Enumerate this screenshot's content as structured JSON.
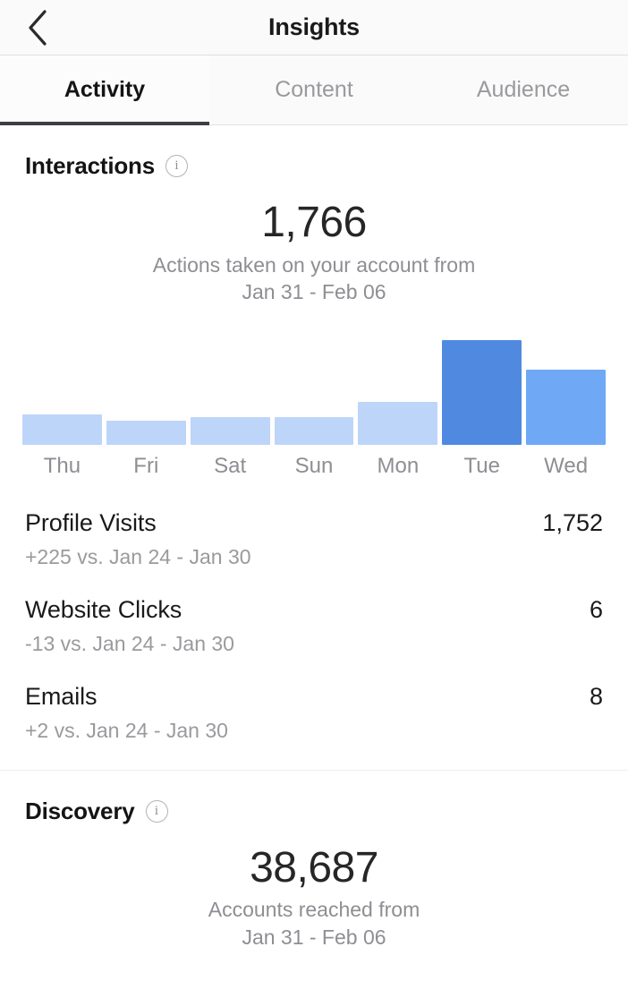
{
  "header": {
    "title": "Insights",
    "back_icon": "chevron-left-icon"
  },
  "tabs": [
    {
      "label": "Activity",
      "active": true
    },
    {
      "label": "Content",
      "active": false
    },
    {
      "label": "Audience",
      "active": false
    }
  ],
  "interactions": {
    "title": "Interactions",
    "info_icon": "info-circle-icon",
    "value": "1,766",
    "description_line1": "Actions taken on your account from",
    "description_line2": "Jan 31 - Feb 06",
    "metrics": [
      {
        "name": "Profile Visits",
        "value": "1,752",
        "sub": "+225 vs. Jan 24 - Jan 30"
      },
      {
        "name": "Website Clicks",
        "value": "6",
        "sub": "-13 vs. Jan 24 - Jan 30"
      },
      {
        "name": "Emails",
        "value": "8",
        "sub": "+2 vs. Jan 24 - Jan 30"
      }
    ]
  },
  "discovery": {
    "title": "Discovery",
    "info_icon": "info-circle-icon",
    "value": "38,687",
    "description_line1": "Accounts reached from",
    "description_line2": "Jan 31 - Feb 06"
  },
  "colors": {
    "bar_light": "#bed5fa",
    "bar_medium": "#6fa8f5",
    "bar_dark": "#4f8ae0",
    "text_primary": "#1a1a1a",
    "text_secondary": "#8e8e93"
  },
  "chart_data": {
    "type": "bar",
    "title": "Interactions by day",
    "categories": [
      "Thu",
      "Fri",
      "Sat",
      "Sun",
      "Mon",
      "Tue",
      "Wed"
    ],
    "values": [
      34,
      27,
      31,
      31,
      48,
      117,
      84
    ],
    "bar_colors": [
      "#bed5fa",
      "#bed5fa",
      "#bed5fa",
      "#bed5fa",
      "#bed5fa",
      "#4f8ae0",
      "#6fa8f5"
    ],
    "xlabel": "",
    "ylabel": "",
    "ylim": [
      0,
      125
    ],
    "grid": false,
    "legend": "none"
  }
}
